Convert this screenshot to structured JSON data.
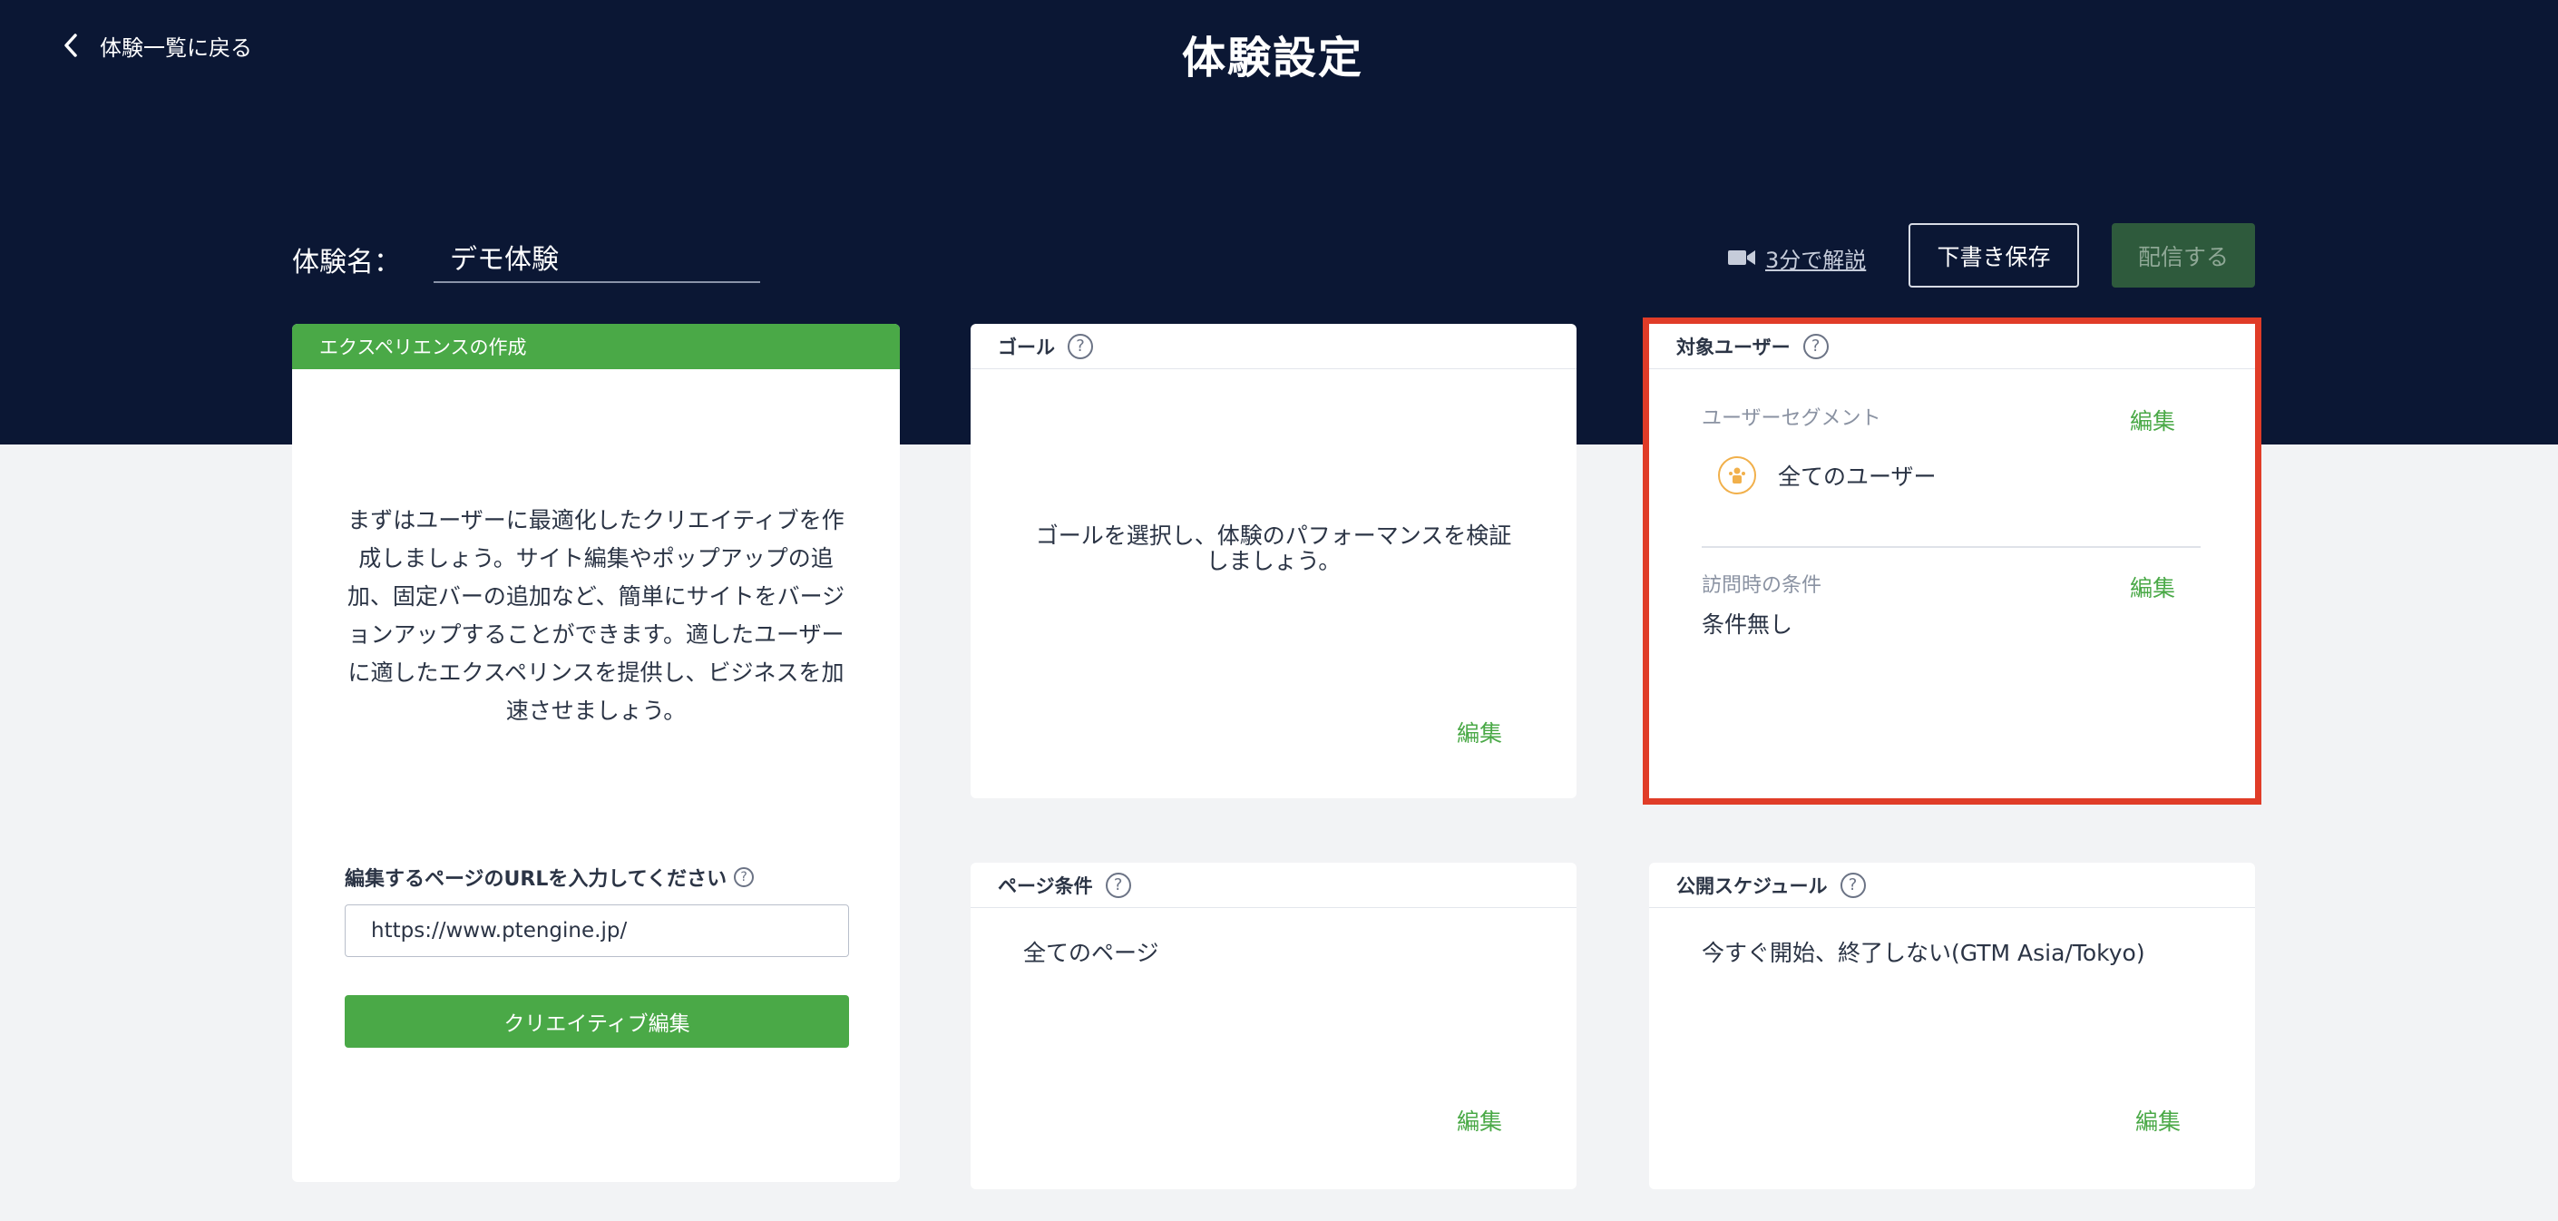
{
  "header": {
    "back_label": "体験一覧に戻る",
    "title": "体験設定",
    "name_label": "体験名：",
    "name_value": "デモ体験",
    "video_link": "3分で解説",
    "draft_button": "下書き保存",
    "publish_button": "配信する"
  },
  "create_card": {
    "title": "エクスペリエンスの作成",
    "description": "まずはユーザーに最適化したクリエイティブを作成しましょう。サイト編集やポップアップの追加、固定バーの追加など、簡単にサイトをバージョンアップすることができます。適したユーザーに適したエクスペリンスを提供し、ビジネスを加速させましょう。",
    "url_label": "編集するページのURLを入力してください",
    "url_value": "https://www.ptengine.jp/",
    "creative_button": "クリエイティブ編集"
  },
  "goal_card": {
    "title": "ゴール",
    "description": "ゴールを選択し、体験のパフォーマンスを検証しましょう。",
    "edit": "編集"
  },
  "target_card": {
    "title": "対象ユーザー",
    "segment_label": "ユーザーセグメント",
    "segment_edit": "編集",
    "segment_value": "全てのユーザー",
    "visit_label": "訪問時の条件",
    "visit_edit": "編集",
    "visit_value": "条件無し"
  },
  "page_card": {
    "title": "ページ条件",
    "value": "全てのページ",
    "edit": "編集"
  },
  "schedule_card": {
    "title": "公開スケジュール",
    "value": "今すぐ開始、終了しない(GTM Asia/Tokyo)",
    "edit": "編集"
  },
  "icons": {
    "back": "chevron-left-icon",
    "video": "video-camera-icon",
    "help": "question-circle-icon",
    "segment": "users-icon"
  },
  "colors": {
    "header_bg": "#0b1734",
    "accent_green": "#4aa947",
    "highlight_red": "#e03c28"
  }
}
